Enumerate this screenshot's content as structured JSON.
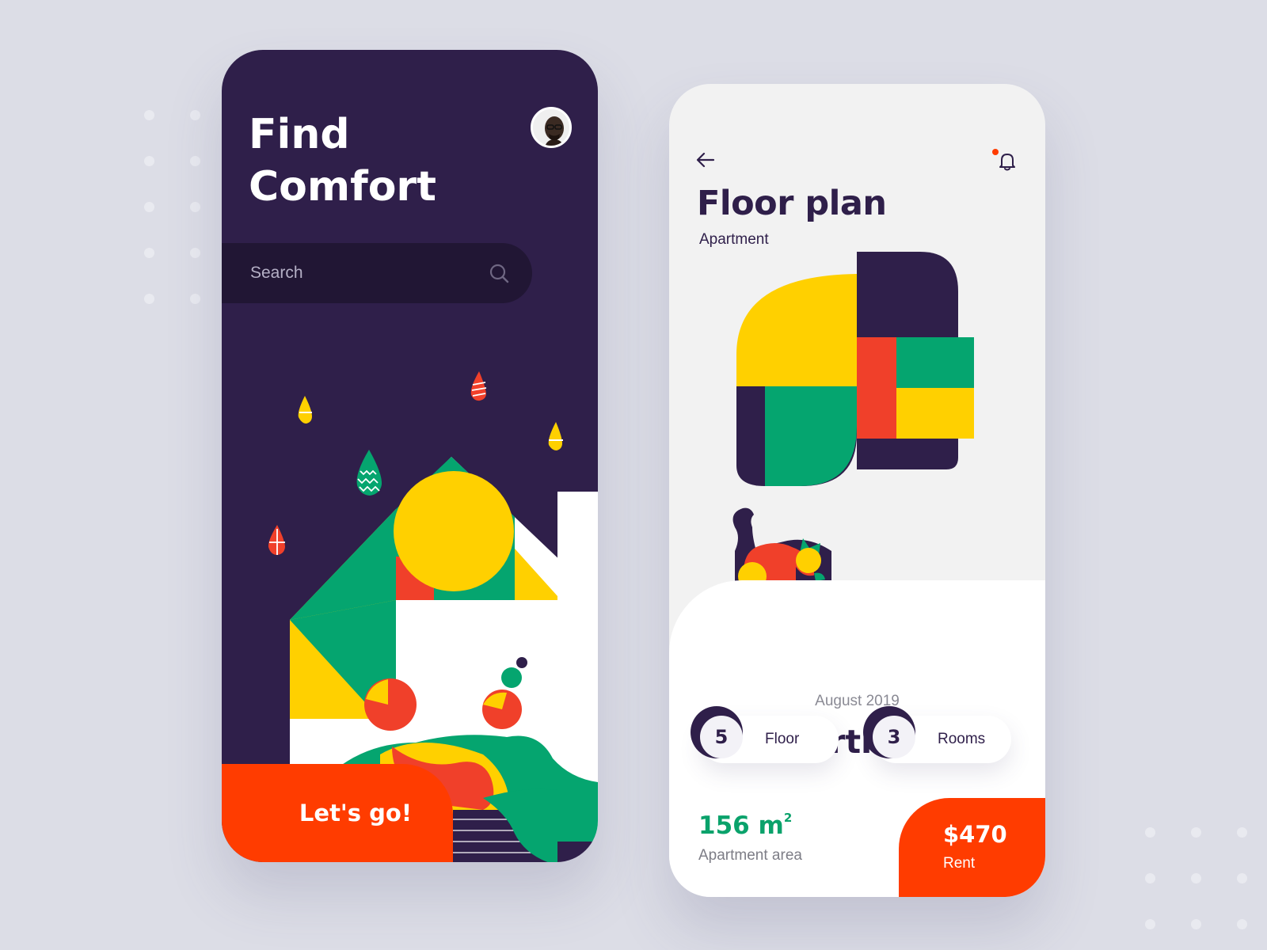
{
  "colors": {
    "background": "#dcdde6",
    "dark_purple": "#2f1f4a",
    "search_bg": "#211634",
    "accent_orange": "#ff3c00",
    "yellow": "#ffd000",
    "green": "#05a56f",
    "red": "#f0402a",
    "light_panel": "#f2f2f2"
  },
  "home_screen": {
    "title_line1": "Find",
    "title_line2": "Comfort",
    "avatar_icon": "user-avatar",
    "search": {
      "placeholder": "Search",
      "icon": "search-icon"
    },
    "cta_label": "Let's go!"
  },
  "detail_screen": {
    "back_icon": "arrow-left-icon",
    "notification_icon": "bell-icon",
    "title": "Floor plan",
    "subtitle": "Apartment",
    "card": {
      "date": "August 2019",
      "title": "Apartment",
      "stats": [
        {
          "value": "5",
          "label": "Floor"
        },
        {
          "value": "3",
          "label": "Rooms"
        }
      ],
      "area": {
        "value": "156 m",
        "superscript": "2",
        "label": "Apartment area"
      },
      "rent": {
        "value": "$470",
        "label": "Rent"
      }
    }
  }
}
